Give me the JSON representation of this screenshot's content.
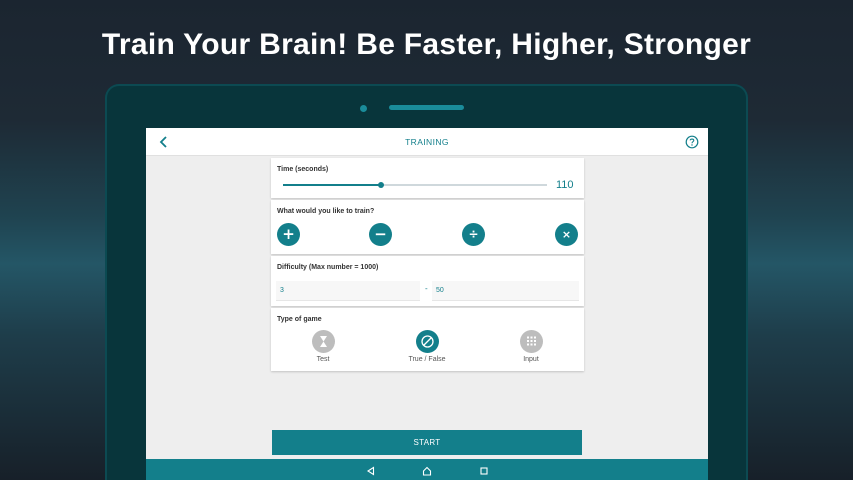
{
  "headline": "Train Your Brain! Be Faster, Higher, Stronger",
  "appbar": {
    "title": "TRAINING"
  },
  "time_card": {
    "label": "Time (seconds)",
    "value": "110",
    "slider_fraction": 0.37
  },
  "operations_card": {
    "label": "What would you like to train?",
    "ops": [
      {
        "name": "plus",
        "symbol": "+"
      },
      {
        "name": "minus",
        "symbol": "−"
      },
      {
        "name": "divide",
        "symbol": "÷"
      },
      {
        "name": "multiply",
        "symbol": "×"
      }
    ]
  },
  "difficulty_card": {
    "label": "Difficulty (Max number = 1000)",
    "min": "3",
    "separator": "-",
    "max": "50"
  },
  "game_type_card": {
    "label": "Type of game",
    "modes": [
      {
        "label": "Test",
        "selected": false
      },
      {
        "label": "True / False",
        "selected": true
      },
      {
        "label": "Input",
        "selected": false
      }
    ]
  },
  "start_label": "START",
  "colors": {
    "accent": "#137f8b",
    "inactive": "#bdbdbd",
    "tablet": "#08353b"
  }
}
